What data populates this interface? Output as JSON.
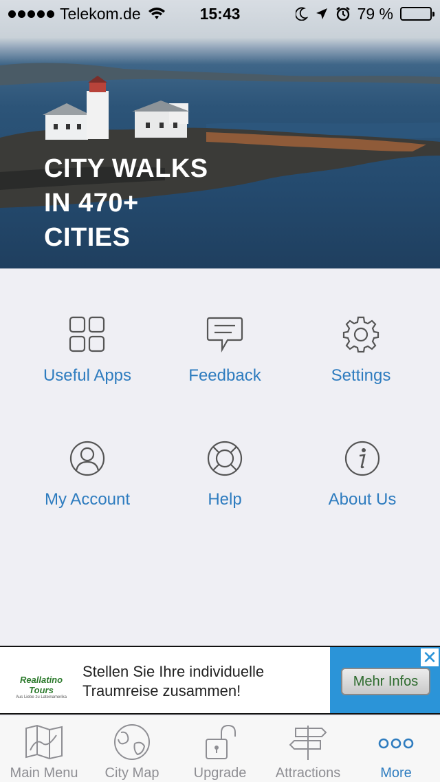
{
  "status_bar": {
    "carrier": "Telekom.de",
    "time": "15:43",
    "battery": "79 %",
    "battery_level": 0.79
  },
  "hero": {
    "title_lines": [
      "CITY WALKS",
      "IN 470+",
      "CITIES"
    ]
  },
  "menu": {
    "items": [
      {
        "label": "Useful Apps",
        "icon": "grid-icon"
      },
      {
        "label": "Feedback",
        "icon": "chat-bubble-icon"
      },
      {
        "label": "Settings",
        "icon": "gear-icon"
      },
      {
        "label": "My Account",
        "icon": "user-icon"
      },
      {
        "label": "Help",
        "icon": "lifebuoy-icon"
      },
      {
        "label": "About Us",
        "icon": "info-icon"
      }
    ],
    "accent_color": "#2e7cbf"
  },
  "ad": {
    "logo_main": "Reallatino Tours",
    "logo_sub": "Aus Liebe zu Lateinamerika",
    "text": "Stellen Sie Ihre individuelle Traumreise zusammen!",
    "cta": "Mehr Infos",
    "close": "✕"
  },
  "tab_bar": {
    "tabs": [
      {
        "label": "Main Menu",
        "icon": "map-icon",
        "active": false
      },
      {
        "label": "City Map",
        "icon": "globe-icon",
        "active": false
      },
      {
        "label": "Upgrade",
        "icon": "unlock-icon",
        "active": false
      },
      {
        "label": "Attractions",
        "icon": "signpost-icon",
        "active": false
      },
      {
        "label": "More",
        "icon": "more-dots-icon",
        "active": true
      }
    ]
  }
}
